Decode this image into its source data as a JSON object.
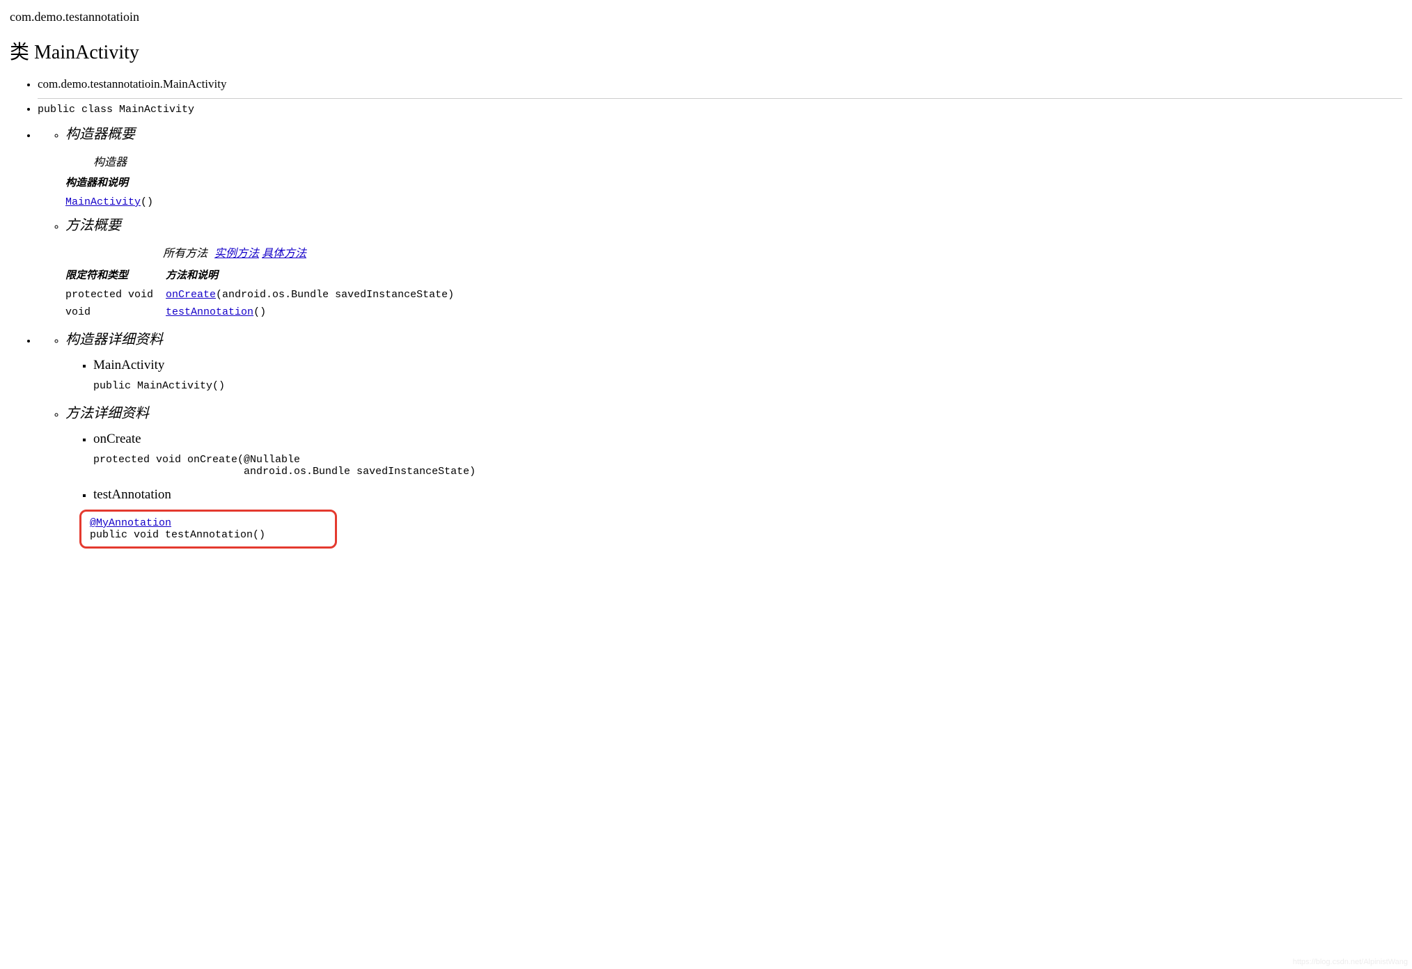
{
  "package_name": "com.demo.testannotatioin",
  "class_title_prefix": "类 ",
  "class_name": "MainActivity",
  "fqcn": "com.demo.testannotatioin.MainActivity",
  "class_decl": "public class MainActivity",
  "sections": {
    "constructor_summary": "构造器概要",
    "constructor_caption": "构造器",
    "constructor_col": "构造器和说明",
    "method_summary": "方法概要",
    "method_col_mod": "限定符和类型",
    "method_col_desc": "方法和说明",
    "constructor_detail": "构造器详细资料",
    "method_detail": "方法详细资料"
  },
  "tabs": {
    "all": "所有方法",
    "instance": "实例方法",
    "concrete": "具体方法"
  },
  "constructors": {
    "link": "MainActivity",
    "sig_suffix": "()"
  },
  "methods": [
    {
      "modifier": "protected void",
      "name": "onCreate",
      "params": "(android.os.Bundle savedInstanceState)"
    },
    {
      "modifier": "void",
      "name": "testAnnotation",
      "params": "()"
    }
  ],
  "constructor_detail": {
    "name": "MainActivity",
    "sig": "public MainActivity()"
  },
  "method_detail": [
    {
      "name": "onCreate",
      "sig": "protected void onCreate(@Nullable\n                        android.os.Bundle savedInstanceState)"
    },
    {
      "name": "testAnnotation",
      "annotation": "@MyAnnotation",
      "sig_line": "public void testAnnotation()"
    }
  ],
  "watermark": "https://blog.csdn.net/AlpinistWang"
}
